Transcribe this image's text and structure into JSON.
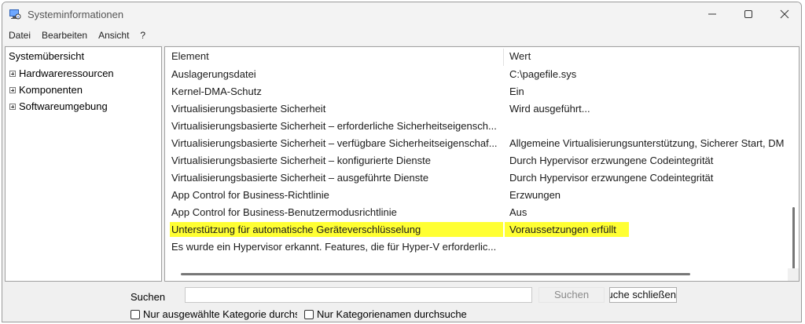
{
  "window": {
    "title": "Systeminformationen"
  },
  "menu": [
    "Datei",
    "Bearbeiten",
    "Ansicht",
    "?"
  ],
  "tree": {
    "root": "Systemübersicht",
    "nodes": [
      "Hardwareressourcen",
      "Komponenten",
      "Softwareumgebung"
    ]
  },
  "table": {
    "columns": [
      "Element",
      "Wert"
    ],
    "rows": [
      {
        "element": "Auslagerungsdatei",
        "value": "C:\\pagefile.sys"
      },
      {
        "element": "Kernel-DMA-Schutz",
        "value": "Ein"
      },
      {
        "element": "Virtualisierungsbasierte Sicherheit",
        "value": "Wird ausgeführt..."
      },
      {
        "element": "Virtualisierungsbasierte Sicherheit – erforderliche Sicherheitseigensch...",
        "value": ""
      },
      {
        "element": "Virtualisierungsbasierte Sicherheit – verfügbare Sicherheitseigenschaf...",
        "value": "Allgemeine Virtualisierungsunterstützung, Sicherer Start, DM"
      },
      {
        "element": "Virtualisierungsbasierte Sicherheit – konfigurierte Dienste",
        "value": "Durch Hypervisor erzwungene Codeintegrität"
      },
      {
        "element": "Virtualisierungsbasierte Sicherheit – ausgeführte Dienste",
        "value": "Durch Hypervisor erzwungene Codeintegrität"
      },
      {
        "element": "App Control for Business-Richtlinie",
        "value": "Erzwungen"
      },
      {
        "element": "App Control for Business-Benutzermodusrichtlinie",
        "value": "Aus"
      },
      {
        "element": "Unterstützung für automatische Geräteverschlüsselung",
        "value": "Voraussetzungen erfüllt"
      },
      {
        "element": "Es wurde ein Hypervisor erkannt. Features, die für Hyper-V erforderlic...",
        "value": ""
      }
    ],
    "highlight_color": "#ffff33"
  },
  "search": {
    "label": "Suchen",
    "value": "",
    "search_button": "Suchen",
    "close_button": "Suche schließen",
    "checkbox_selected_category": "Nur ausgewählte Kategorie durchsuchen",
    "checkbox_category_names": "Nur Kategorienamen durchsuche"
  }
}
